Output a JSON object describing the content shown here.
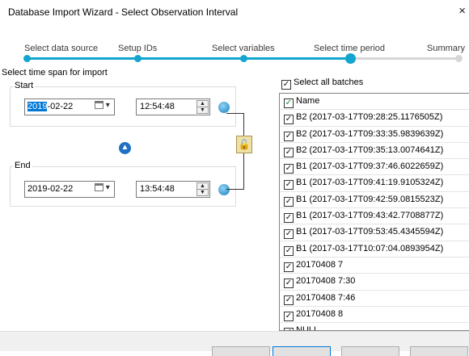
{
  "window": {
    "title": "Database Import Wizard - Select Observation Interval",
    "close_glyph": "×"
  },
  "steps": [
    {
      "label": "Select data source"
    },
    {
      "label": "Setup IDs"
    },
    {
      "label": "Select variables"
    },
    {
      "label": "Select time period"
    },
    {
      "label": "Summary"
    }
  ],
  "time_span": {
    "section_label": "Select time span for import",
    "start": {
      "legend": "Start",
      "date_highlight": "2019",
      "date_rest": "-02-22",
      "time": "12:54:48"
    },
    "end": {
      "legend": "End",
      "date": "2019-02-22",
      "time": "13:54:48"
    }
  },
  "batches": {
    "select_all_label": "Select all batches",
    "header": "Name",
    "items": [
      "B2 (2017-03-17T09:28:25.1176505Z)",
      "B2 (2017-03-17T09:33:35.9839639Z)",
      "B2 (2017-03-17T09:35:13.0074641Z)",
      "B1 (2017-03-17T09:37:46.6022659Z)",
      "B1 (2017-03-17T09:41:19.9105324Z)",
      "B1 (2017-03-17T09:42:59.0815523Z)",
      "B1 (2017-03-17T09:43:42.7708877Z)",
      "B1 (2017-03-17T09:53:45.4345594Z)",
      "B1 (2017-03-17T10:07:04.0893954Z)",
      "20170408 7",
      "20170408 7:30",
      "20170408 7:46",
      "20170408 8",
      "NULL"
    ]
  },
  "colors": {
    "accent": "#11a5cf",
    "track_inactive": "#d6d6d6",
    "selection": "#0078d7"
  }
}
